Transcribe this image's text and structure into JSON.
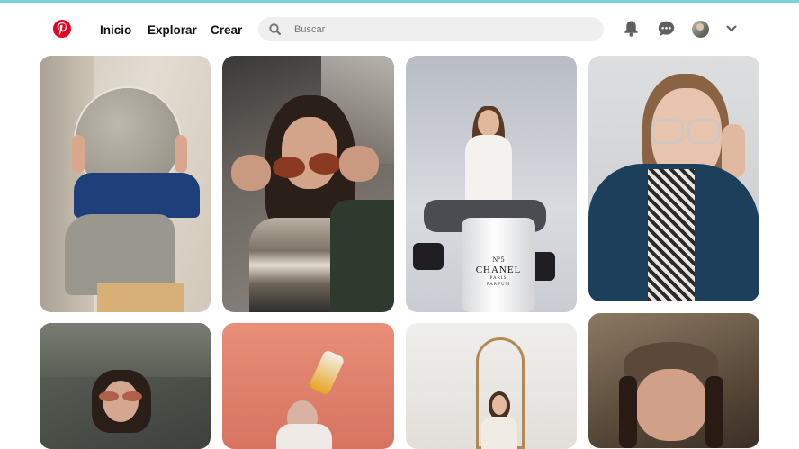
{
  "accent_color": "#e60023",
  "header": {
    "logo_icon": "pinterest-logo-icon",
    "nav": [
      {
        "label": "Inicio"
      },
      {
        "label": "Explorar"
      },
      {
        "label": "Crear"
      }
    ],
    "search": {
      "placeholder": "Buscar",
      "value": ""
    },
    "icons": [
      "bell-icon",
      "chat-bubble-icon",
      "avatar",
      "chevron-down-icon"
    ]
  },
  "pins": [
    {
      "subject": "woman-holding-round-mirror"
    },
    {
      "subject": "woman-holding-sunglasses"
    },
    {
      "subject": "woman-sitting-on-chanel-barrel",
      "barrel_text": {
        "line1": "N°5",
        "line2": "CHANEL",
        "line3": "PARIS",
        "line4": "PARFUM"
      }
    },
    {
      "subject": "woman-with-clear-glasses"
    },
    {
      "subject": "woman-with-round-sunglasses"
    },
    {
      "subject": "man-with-flying-sneaker"
    },
    {
      "subject": "woman-under-arch"
    },
    {
      "subject": "woman-with-flat-cap"
    }
  ]
}
